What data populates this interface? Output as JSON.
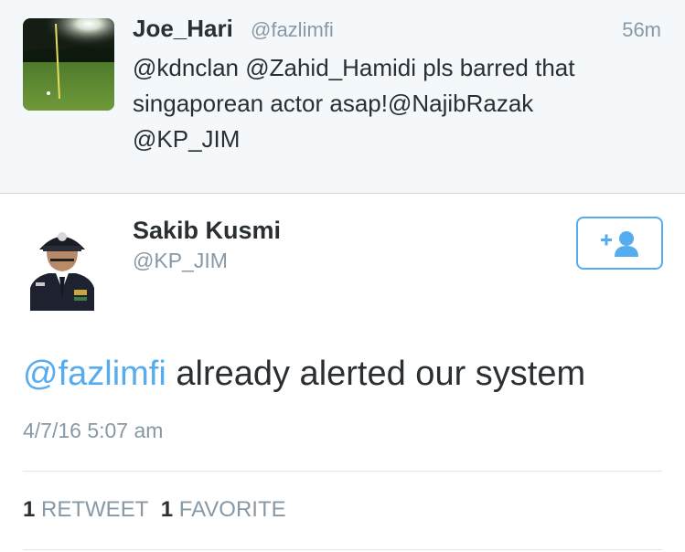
{
  "reply_tweet": {
    "avatar": "golf-course-night-avatar",
    "name": "Joe_Hari",
    "handle": "@fazlimfi",
    "time": "56m",
    "text_lines": [
      "@kdnclan @Zahid_Hamidi pls barred that",
      "singaporean actor asap!@NajibRazak",
      "@KP_JIM"
    ]
  },
  "main_tweet": {
    "avatar": "police-officer-avatar",
    "name": "Sakib Kusmi",
    "handle": "@KP_JIM",
    "follow_icon": "add-user-icon",
    "mention": "@fazlimfi",
    "text_rest": " already alerted our system",
    "timestamp": "4/7/16 5:07 am",
    "retweet_count": "1",
    "retweet_label": "RETWEET",
    "favorite_count": "1",
    "favorite_label": "FAVORITE"
  },
  "colors": {
    "accent": "#55acee",
    "muted": "#8899a6",
    "text": "#292f33",
    "reply_background": "#f5f8fa"
  }
}
